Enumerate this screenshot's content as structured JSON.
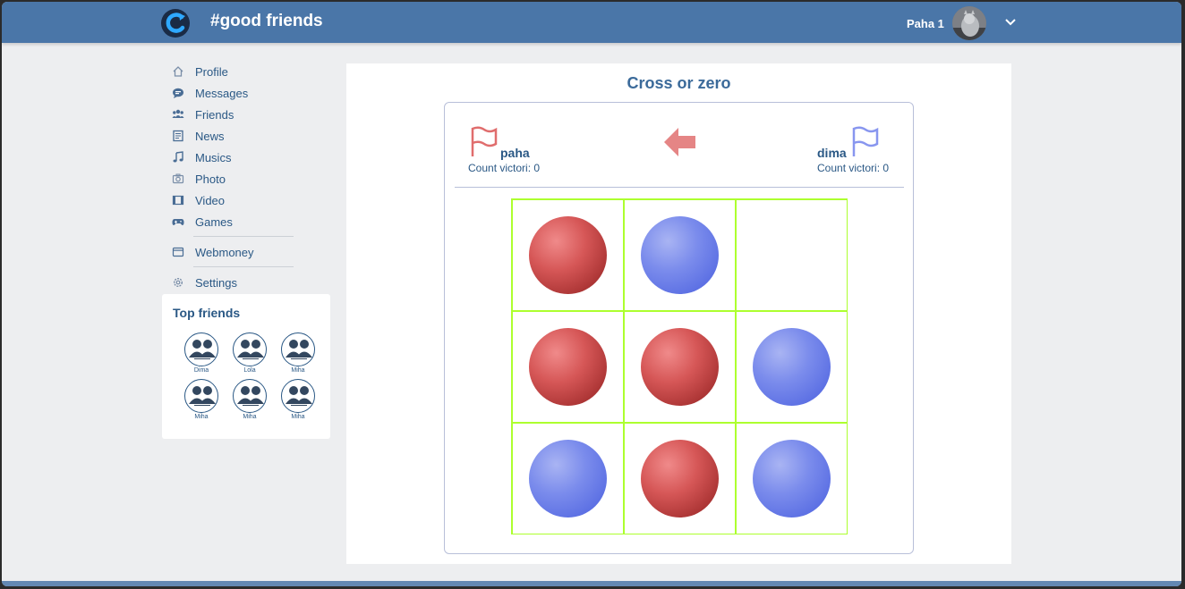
{
  "header": {
    "site_title": "#good friends",
    "user_name": "Paha 1"
  },
  "sidebar": {
    "items": [
      {
        "label": "Profile",
        "icon": "home-icon"
      },
      {
        "label": "Messages",
        "icon": "chat-icon"
      },
      {
        "label": "Friends",
        "icon": "friends-icon"
      },
      {
        "label": "News",
        "icon": "news-icon"
      },
      {
        "label": "Musics",
        "icon": "music-icon"
      },
      {
        "label": "Photo",
        "icon": "camera-icon"
      },
      {
        "label": "Video",
        "icon": "video-icon"
      },
      {
        "label": "Games",
        "icon": "gamepad-icon"
      },
      {
        "label": "Webmoney",
        "icon": "wallet-icon"
      },
      {
        "label": "Settings",
        "icon": "gear-icon"
      }
    ]
  },
  "top_friends": {
    "title": "Top friends",
    "friends": [
      {
        "name": "Dima"
      },
      {
        "name": "Lola"
      },
      {
        "name": "Miha"
      },
      {
        "name": "Miha"
      },
      {
        "name": "Miha"
      },
      {
        "name": "Miha"
      }
    ]
  },
  "game": {
    "title": "Cross or zero",
    "player1": {
      "name": "paha",
      "count": "Count victori: 0",
      "color": "#e06d6d"
    },
    "player2": {
      "name": "dima",
      "count": "Count victori: 0",
      "color": "#7b8cec"
    },
    "turn": "player1",
    "board": [
      "red",
      "blue",
      "",
      "red",
      "red",
      "blue",
      "blue",
      "red",
      "blue"
    ]
  },
  "colors": {
    "accent": "#4a76a8",
    "link": "#2a5885",
    "grid": "#adff2f",
    "red_piece": "#c94545",
    "blue_piece": "#6577e8"
  }
}
